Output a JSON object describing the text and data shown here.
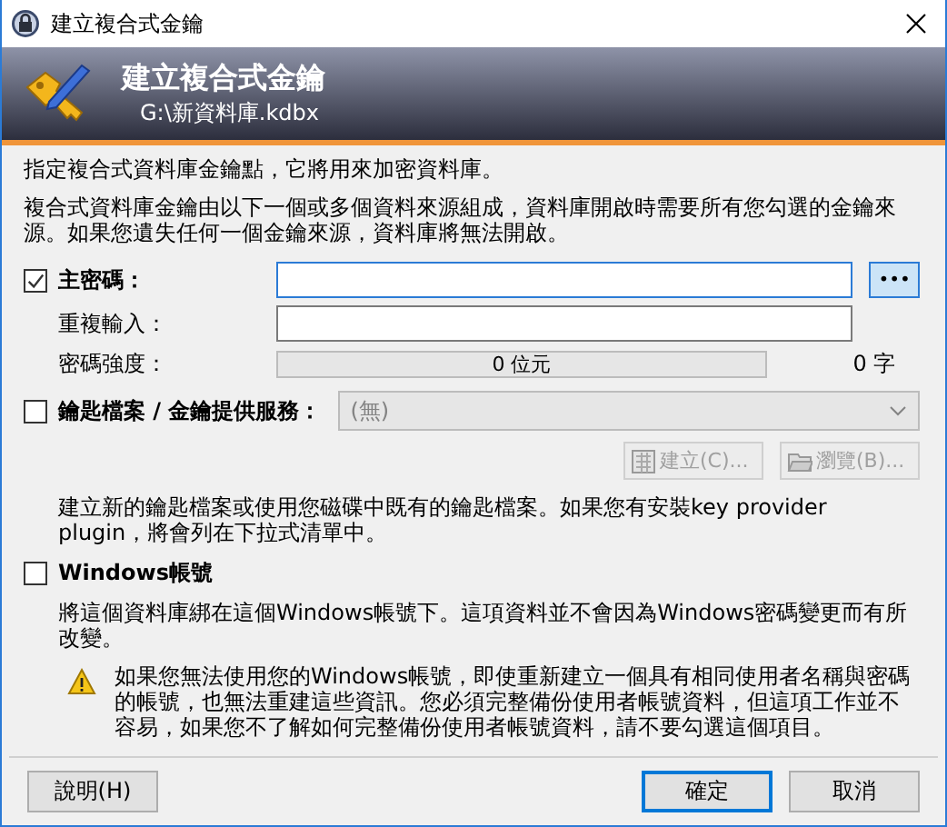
{
  "window": {
    "title": "建立複合式金鑰"
  },
  "banner": {
    "title": "建立複合式金鑰",
    "subtitle": "G:\\新資料庫.kdbx"
  },
  "intro": "指定複合式資料庫金鑰點，它將用來加密資料庫。",
  "description": "複合式資料庫金鑰由以下一個或多個資料來源組成，資料庫開啟時需要所有您勾選的金鑰來源。如果您遺失任何一個金鑰來源，資料庫將無法開啟。",
  "master_password": {
    "label": "主密碼：",
    "checked": true,
    "repeat_label": "重複輸入：",
    "reveal_button": "•••",
    "strength_label": "密碼強度：",
    "strength_reading": "0 位元",
    "char_count": "0 字"
  },
  "key_file": {
    "label": "鑰匙檔案 / 金鑰提供服務：",
    "checked": false,
    "dropdown": {
      "value": "(無)",
      "disabled": true
    },
    "buttons": [
      {
        "label": "建立(C)...",
        "kind": "create",
        "disabled": true
      },
      {
        "label": "瀏覽(B)...",
        "kind": "browse",
        "disabled": true
      }
    ],
    "note": "建立新的鑰匙檔案或使用您磁碟中既有的鑰匙檔案。如果您有安裝key provider plugin，將會列在下拉式清單中。"
  },
  "windows_account": {
    "label": "Windows帳號",
    "checked": false,
    "note": "將這個資料庫綁在這個Windows帳號下。這項資料並不會因為Windows密碼變更而有所改變。",
    "warning": "如果您無法使用您的Windows帳號，即使重新建立一個具有相同使用者名稱與密碼的帳號，也無法重建這些資訊。您必須完整備份使用者帳號資料，但這項工作並不容易，如果您不了解如何完整備份使用者帳號資料，請不要勾選這個項目。"
  },
  "buttons": [
    {
      "label": "說明(H)",
      "default": false
    },
    {
      "label": "確定",
      "default": true
    },
    {
      "label": "取消",
      "default": false
    }
  ]
}
